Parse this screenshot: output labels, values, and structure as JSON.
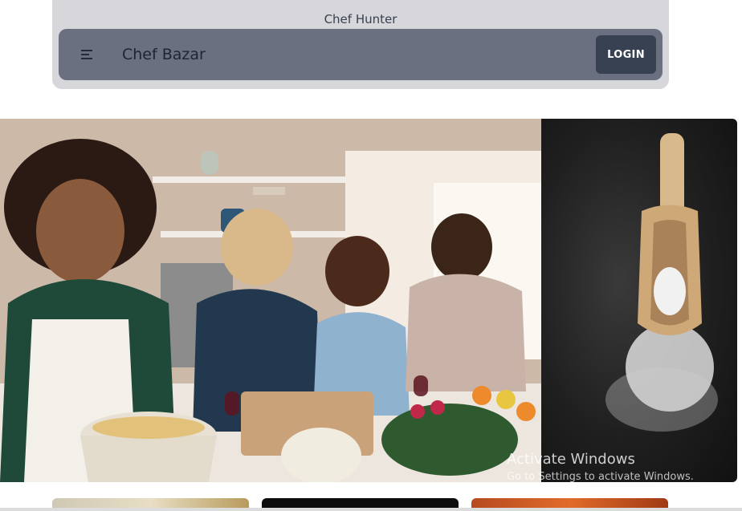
{
  "header": {
    "brand_top": "Chef Hunter",
    "navbar_title": "Chef Bazar",
    "menu_icon": "menu-icon",
    "login_label": "LOGIN"
  },
  "colors": {
    "header_bg": "#d6d6db",
    "navbar_bg": "#6b7080",
    "login_bg": "#374151"
  },
  "watermark": {
    "title": "Activate Windows",
    "subtitle": "Go to Settings to activate Windows."
  }
}
